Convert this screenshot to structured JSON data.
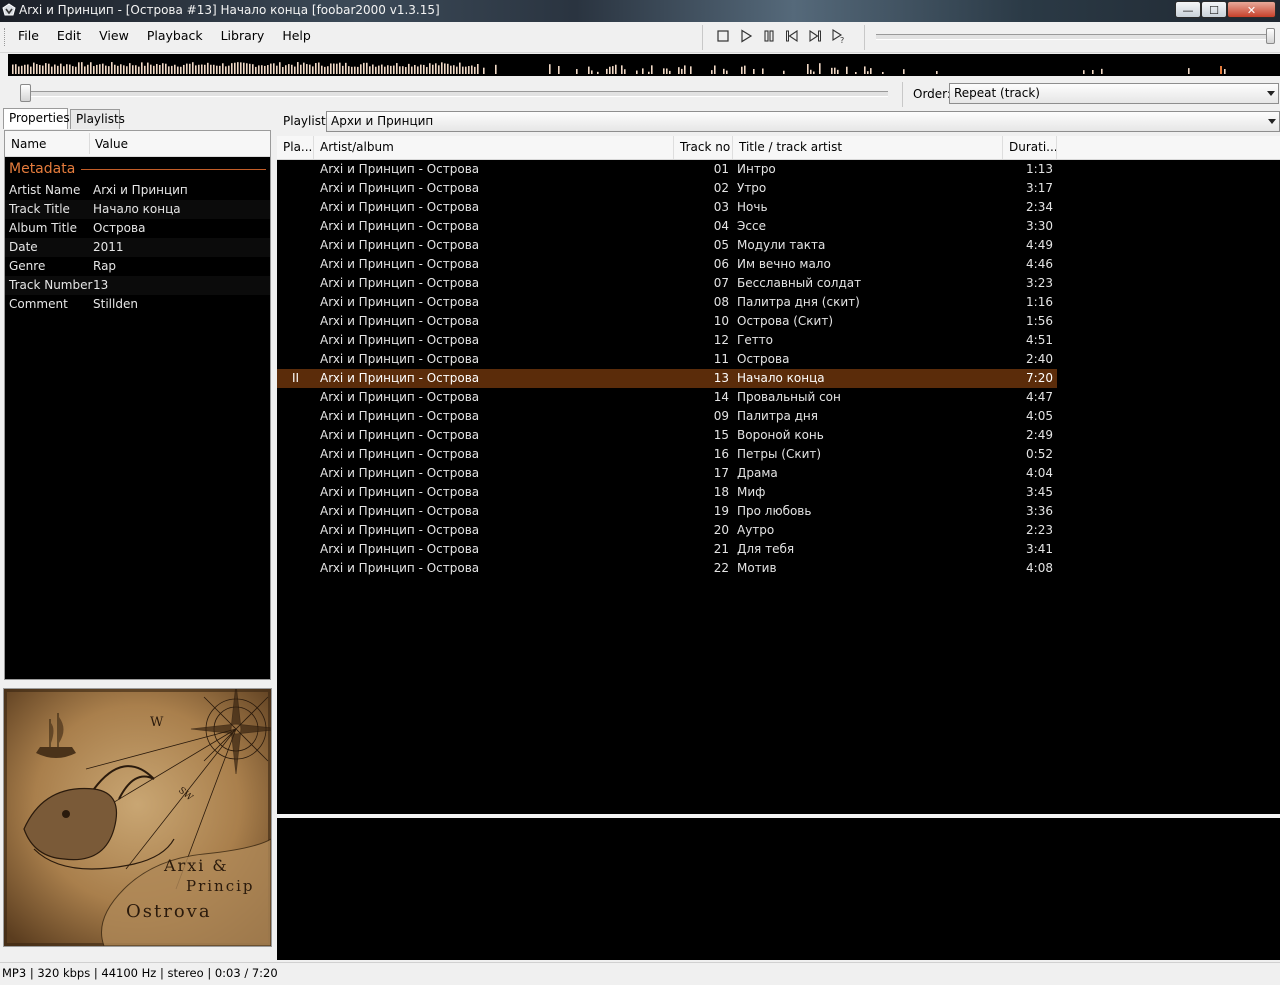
{
  "window": {
    "title": "Arxi и Принцип - [Острова #13] Начало конца   [foobar2000 v1.3.15]",
    "controls": {
      "minimize": "—",
      "maximize": "☐",
      "close": "✕"
    }
  },
  "menu": [
    "File",
    "Edit",
    "View",
    "Playback",
    "Library",
    "Help"
  ],
  "toolbar": {
    "buttons": [
      "stop-icon",
      "play-icon",
      "pause-icon",
      "previous-icon",
      "next-icon",
      "random-icon"
    ],
    "volume_level": 1.0
  },
  "seekbar": {
    "position_fraction": 0.007
  },
  "order": {
    "label": "Order:",
    "value": "Repeat (track)"
  },
  "left_tabs": [
    "Properties",
    "Playlists"
  ],
  "properties": {
    "columns": {
      "name": "Name",
      "value": "Value"
    },
    "section": "Metadata",
    "rows": [
      {
        "name": "Artist Name",
        "value": "Arxi и Принцип"
      },
      {
        "name": "Track Title",
        "value": "Начало конца"
      },
      {
        "name": "Album Title",
        "value": "Острова"
      },
      {
        "name": "Date",
        "value": "2011"
      },
      {
        "name": "Genre",
        "value": "Rap"
      },
      {
        "name": "Track Number",
        "value": "13"
      },
      {
        "name": "Comment",
        "value": "Stillden"
      }
    ]
  },
  "album_art": {
    "lines": [
      "Arxi &",
      "Princip",
      "Ostrova"
    ],
    "compass": [
      "W",
      "SW"
    ]
  },
  "playlist": {
    "label": "Playlist:",
    "selected": "Архи и Принцип",
    "columns": {
      "playing": "Pla...",
      "artist": "Artist/album",
      "trackno": "Track no",
      "title": "Title / track artist",
      "duration": "Durati..."
    },
    "playing_indicator": "II",
    "tracks": [
      {
        "artist": "Arxi и Принцип - Острова",
        "no": "01",
        "title": "Интро",
        "duration": "1:13",
        "playing": false
      },
      {
        "artist": "Arxi и Принцип - Острова",
        "no": "02",
        "title": "Утро",
        "duration": "3:17",
        "playing": false
      },
      {
        "artist": "Arxi и Принцип - Острова",
        "no": "03",
        "title": "Ночь",
        "duration": "2:34",
        "playing": false
      },
      {
        "artist": "Arxi и Принцип - Острова",
        "no": "04",
        "title": "Эссе",
        "duration": "3:30",
        "playing": false
      },
      {
        "artist": "Arxi и Принцип - Острова",
        "no": "05",
        "title": "Модули такта",
        "duration": "4:49",
        "playing": false
      },
      {
        "artist": "Arxi и Принцип - Острова",
        "no": "06",
        "title": "Им вечно мало",
        "duration": "4:46",
        "playing": false
      },
      {
        "artist": "Arxi и Принцип - Острова",
        "no": "07",
        "title": "Бесславный солдат",
        "duration": "3:23",
        "playing": false
      },
      {
        "artist": "Arxi и Принцип - Острова",
        "no": "08",
        "title": "Палитра дня (скит)",
        "duration": "1:16",
        "playing": false
      },
      {
        "artist": "Arxi и Принцип - Острова",
        "no": "10",
        "title": "Острова (Скит)",
        "duration": "1:56",
        "playing": false
      },
      {
        "artist": "Arxi и Принцип - Острова",
        "no": "12",
        "title": "Гетто",
        "duration": "4:51",
        "playing": false
      },
      {
        "artist": "Arxi и Принцип - Острова",
        "no": "11",
        "title": "Острова",
        "duration": "2:40",
        "playing": false
      },
      {
        "artist": "Arxi и Принцип - Острова",
        "no": "13",
        "title": "Начало конца",
        "duration": "7:20",
        "playing": true
      },
      {
        "artist": "Arxi и Принцип - Острова",
        "no": "14",
        "title": "Провальный сон",
        "duration": "4:47",
        "playing": false
      },
      {
        "artist": "Arxi и Принцип - Острова",
        "no": "09",
        "title": "Палитра дня",
        "duration": "4:05",
        "playing": false
      },
      {
        "artist": "Arxi и Принцип - Острова",
        "no": "15",
        "title": "Вороной конь",
        "duration": "2:49",
        "playing": false
      },
      {
        "artist": "Arxi и Принцип - Острова",
        "no": "16",
        "title": "Петры (Скит)",
        "duration": "0:52",
        "playing": false
      },
      {
        "artist": "Arxi и Принцип - Острова",
        "no": "17",
        "title": "Драма",
        "duration": "4:04",
        "playing": false
      },
      {
        "artist": "Arxi и Принцип - Острова",
        "no": "18",
        "title": "Миф",
        "duration": "3:45",
        "playing": false
      },
      {
        "artist": "Arxi и Принцип - Острова",
        "no": "19",
        "title": "Про любовь",
        "duration": "3:36",
        "playing": false
      },
      {
        "artist": "Arxi и Принцип - Острова",
        "no": "20",
        "title": "Аутро",
        "duration": "2:23",
        "playing": false
      },
      {
        "artist": "Arxi и Принцип - Острова",
        "no": "21",
        "title": "Для тебя",
        "duration": "3:41",
        "playing": false
      },
      {
        "artist": "Arxi и Принцип - Острова",
        "no": "22",
        "title": "Мотив",
        "duration": "4:08",
        "playing": false
      }
    ]
  },
  "status": "MP3 | 320 kbps | 44100 Hz | stereo | 0:03 / 7:20",
  "colors": {
    "accent": "#e57c3c",
    "now_playing_row": "#5b2c0a",
    "visualisation_bar": "#f1d9c6",
    "list_background": "#000000"
  }
}
